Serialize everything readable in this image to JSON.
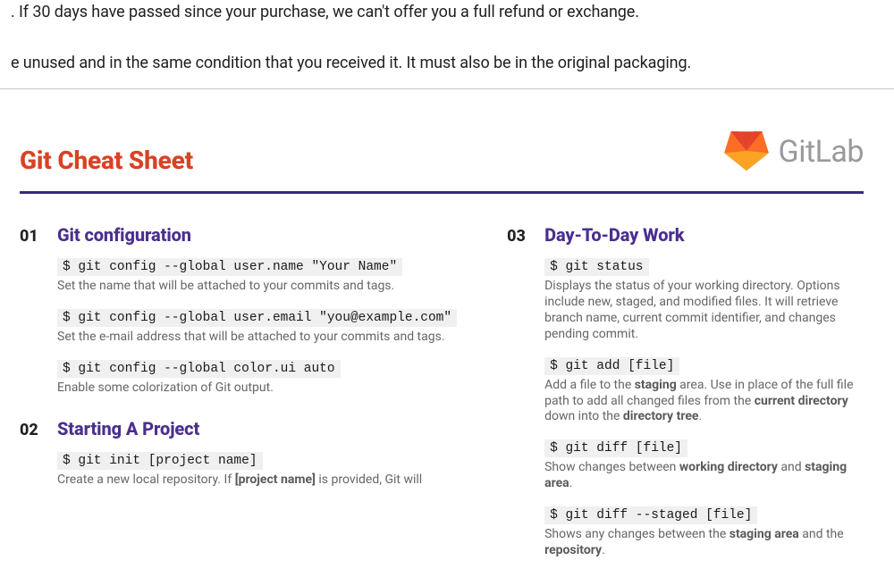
{
  "page_top": {
    "line1": ". If 30 days have passed since your purchase, we can't offer you a full refund or exchange.",
    "line2": "e unused and in the same condition that you received it. It must also be in the original packaging."
  },
  "sheet": {
    "title": "Git Cheat Sheet",
    "brand": "GitLab",
    "sections_left": [
      {
        "num": "01",
        "title": "Git configuration",
        "items": [
          {
            "cmd": "$ git config --global user.name \"Your Name\"",
            "desc": "Set the name that will be attached to your commits and tags."
          },
          {
            "cmd": "$ git config --global user.email \"you@example.com\"",
            "desc": "Set the e-mail address that will be attached to your commits and tags."
          },
          {
            "cmd": "$ git config --global color.ui auto",
            "desc": "Enable some colorization of Git output."
          }
        ]
      },
      {
        "num": "02",
        "title": "Starting A Project",
        "items": [
          {
            "cmd": "$ git init [project name]",
            "desc": "Create a new local repository. If <b>[project name]</b> is provided, Git will"
          }
        ]
      }
    ],
    "sections_right": [
      {
        "num": "03",
        "title": "Day-To-Day Work",
        "items": [
          {
            "cmd": "$ git status",
            "desc": "Displays the status of your working directory. Options include new, staged, and modified files. It will retrieve branch name, current commit identifier, and changes pending commit."
          },
          {
            "cmd": "$ git add [file]",
            "desc": "Add a file to the <b>staging</b> area. Use in place of the full file path to add all changed files from the <b>current directory</b> down into the <b>directory tree</b>."
          },
          {
            "cmd": "$ git diff [file]",
            "desc": "Show changes between <b>working directory</b> and <b>staging area</b>."
          },
          {
            "cmd": "$ git diff --staged [file]",
            "desc": "Shows any changes between the <b>staging area</b> and the <b>repository</b>."
          }
        ]
      }
    ]
  }
}
